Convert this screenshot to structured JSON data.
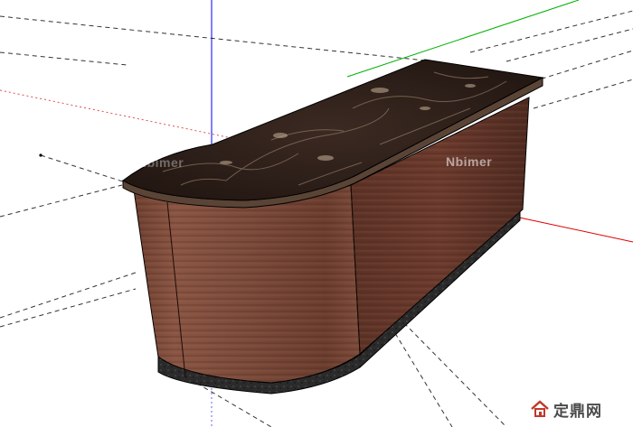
{
  "watermark_main": "Nbimer",
  "watermark_secondary": "Nbimer",
  "site_logo": {
    "text": "定鼎网",
    "url": "www.dingding.com",
    "icon": "house-logo-icon"
  },
  "colors": {
    "axis_red": "#ff0000",
    "axis_green": "#00b000",
    "axis_blue": "#0000ff",
    "wood_dark": "#5a3426",
    "wood_light": "#8a5a45",
    "marble": "#2b1c16",
    "base": "#2a2a2a"
  }
}
